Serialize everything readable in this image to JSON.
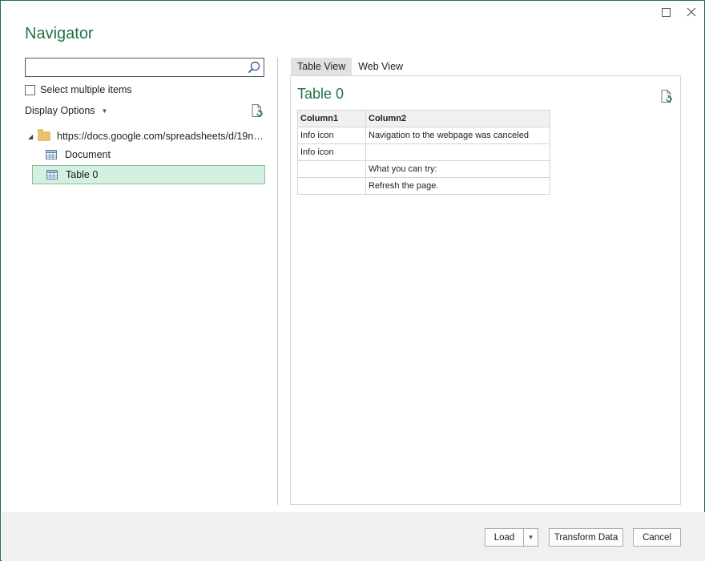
{
  "window": {
    "title": "Navigator",
    "controls": {
      "maximize_icon": "square-icon",
      "close_icon": "close-icon"
    }
  },
  "left": {
    "search": {
      "value": "",
      "placeholder": "",
      "icon": "search-icon"
    },
    "select_multiple_label": "Select multiple items",
    "display_options_label": "Display Options",
    "tree": {
      "root_label": "https://docs.google.com/spreadsheets/d/19nR...",
      "items": [
        {
          "label": "Document",
          "selected": false
        },
        {
          "label": "Table 0",
          "selected": true
        }
      ]
    }
  },
  "right": {
    "tabs": [
      {
        "label": "Table View",
        "active": true
      },
      {
        "label": "Web View",
        "active": false
      }
    ],
    "preview_title": "Table 0",
    "table": {
      "columns": [
        "Column1",
        "Column2"
      ],
      "rows": [
        [
          "Info icon",
          "Navigation to the webpage was canceled"
        ],
        [
          "Info icon",
          ""
        ],
        [
          "",
          "What you can try:"
        ],
        [
          "",
          "Refresh the page."
        ]
      ]
    }
  },
  "footer": {
    "load_label": "Load",
    "transform_label": "Transform Data",
    "cancel_label": "Cancel"
  },
  "colors": {
    "accent": "#217346",
    "selected_bg": "#d3f0e0",
    "folder": "#e8c170"
  }
}
